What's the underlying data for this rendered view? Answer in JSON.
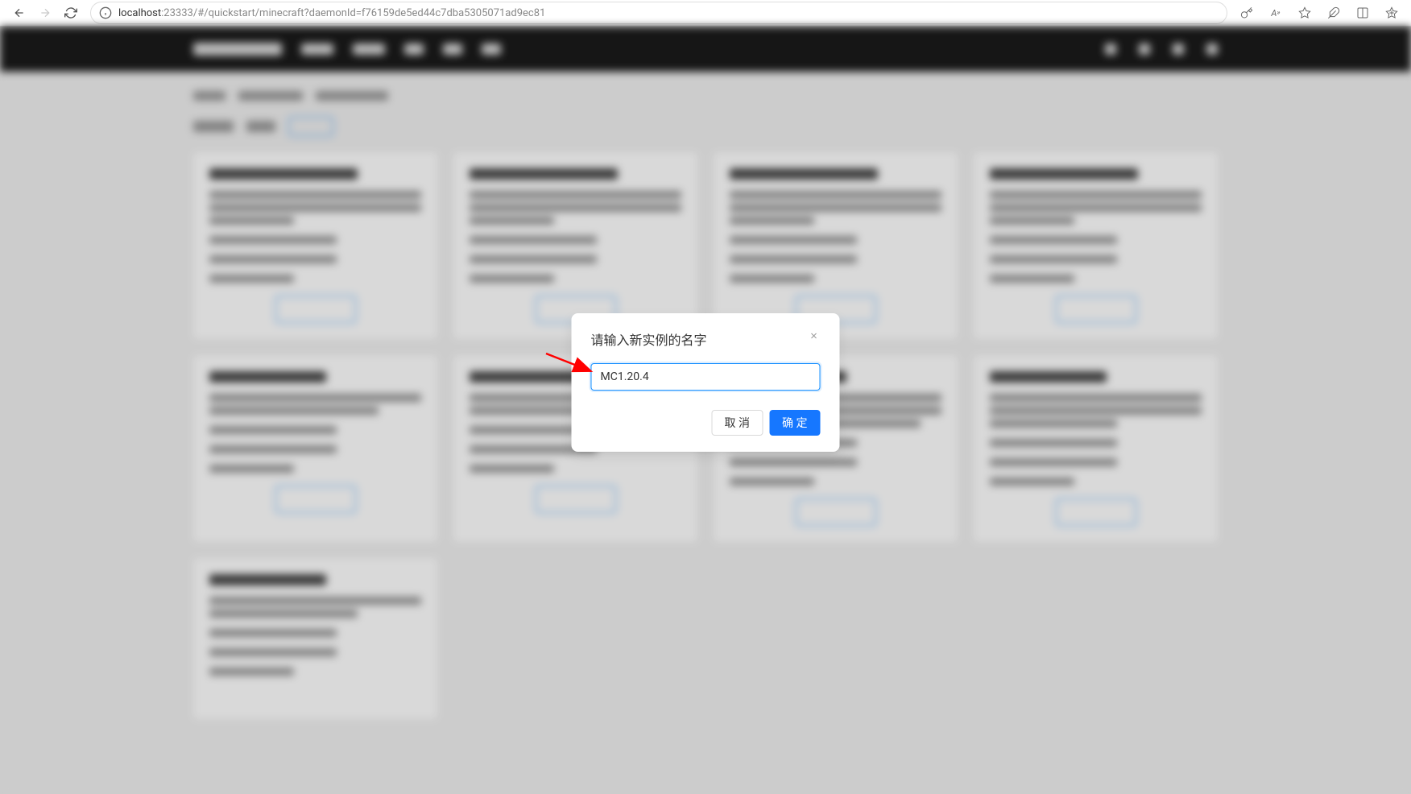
{
  "browser": {
    "url_host": "localhost",
    "url_port": ":23333",
    "url_path": "/#/quickstart/minecraft?daemonId=f76159de5ed44c7dba5305071ad9ec81"
  },
  "modal": {
    "title": "请输入新实例的名字",
    "input_value": "MC1.20.4",
    "cancel_label": "取 消",
    "confirm_label": "确 定"
  }
}
